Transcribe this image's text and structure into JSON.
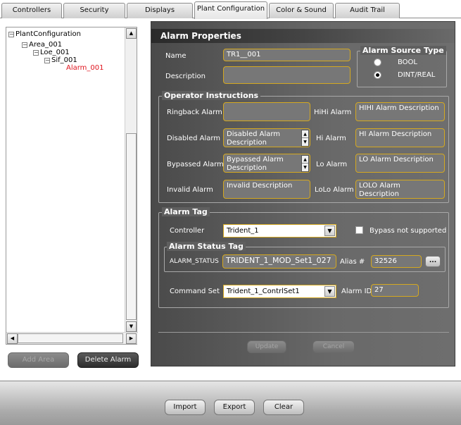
{
  "tabs": [
    "Controllers",
    "Security",
    "Displays",
    "Plant Configuration",
    "Color & Sound",
    "Audit Trail"
  ],
  "active_tab": "Plant Configuration",
  "tree": {
    "root": "PlantConfiguration",
    "area": "Area_001",
    "loe": "Loe_001",
    "sif": "Sif_001",
    "alarm": "Alarm_001"
  },
  "left_buttons": {
    "add_area": "Add Area",
    "delete_alarm": "Delete Alarm"
  },
  "alarm_properties": {
    "title": "Alarm Properties",
    "name_label": "Name",
    "name_value": "TR1__001",
    "description_label": "Description",
    "description_value": "",
    "source_type": {
      "title": "Alarm Source Type",
      "option_bool": "BOOL",
      "option_dint": "DINT/REAL",
      "selected": "DINT/REAL"
    }
  },
  "operator_instructions": {
    "title": "Operator Instructions",
    "ringback_label": "Ringback Alarm",
    "ringback_value": "",
    "disabled_label": "Disabled Alarm",
    "disabled_value": "Disabled Alarm Description",
    "bypassed_label": "Bypassed Alarm",
    "bypassed_value": "Bypassed Alarm Description",
    "invalid_label": "Invalid Alarm",
    "invalid_value": "Invalid Description",
    "hihi_label": "HiHi Alarm",
    "hihi_value": "HIHI Alarm Description",
    "hi_label": "Hi Alarm",
    "hi_value": "HI Alarm Description",
    "lo_label": "Lo Alarm",
    "lo_value": "LO Alarm Description",
    "lolo_label": "LoLo Alarm",
    "lolo_value": "LOLO Alarm Description"
  },
  "alarm_tag": {
    "title": "Alarm Tag",
    "controller_label": "Controller",
    "controller_value": "Trident_1",
    "bypass_label": "Bypass not supported",
    "status_tag": {
      "title": "Alarm Status Tag",
      "label": "ALARM_STATUS",
      "value": "TRIDENT_1_MOD_Set1_027",
      "alias_label": "Alias #",
      "alias_value": "32526",
      "browse_label": "..."
    },
    "command_set_label": "Command Set",
    "command_set_value": "Trident_1_ContrlSet1",
    "alarm_id_label": "Alarm ID",
    "alarm_id_value": "27"
  },
  "panel_buttons": {
    "update": "Update",
    "cancel": "Cancel"
  },
  "bottom_buttons": {
    "import": "Import",
    "export": "Export",
    "clear": "Clear"
  }
}
